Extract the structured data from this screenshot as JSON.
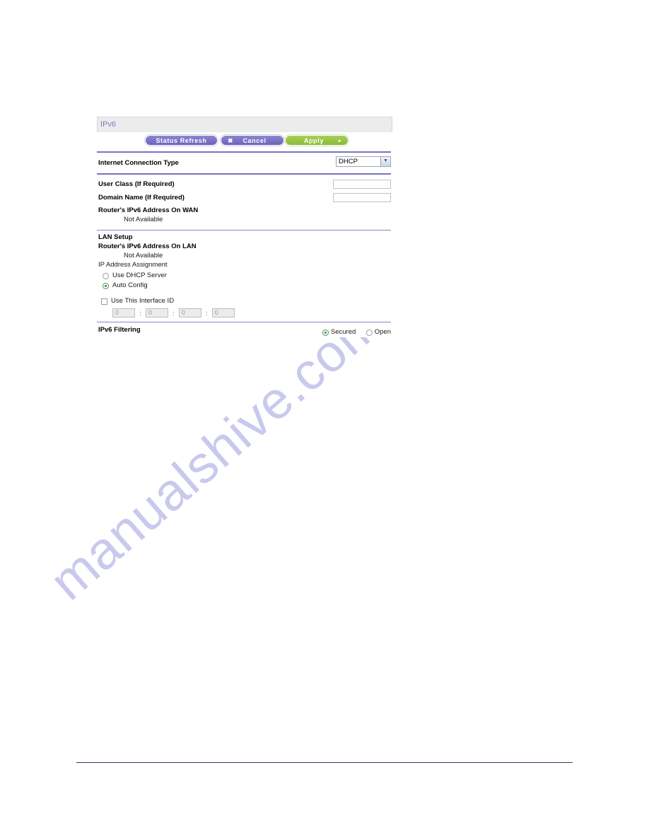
{
  "panel": {
    "title": "IPv6",
    "buttons": {
      "status_refresh": "Status Refresh",
      "cancel": "Cancel",
      "cancel_icon": "✖",
      "apply": "Apply",
      "apply_icon": "▸"
    },
    "internet_connection_type": {
      "label": "Internet Connection Type",
      "selected": "DHCP",
      "options": [
        "DHCP"
      ],
      "dropdown_icon": "▼"
    },
    "user_class": {
      "label": "User Class  (If Required)",
      "value": "",
      "placeholder": ""
    },
    "domain_name": {
      "label": "Domain Name   (If Required)",
      "value": "",
      "placeholder": ""
    },
    "wan_address": {
      "label": "Router's IPv6 Address On WAN",
      "value": "Not Available"
    },
    "lan_setup": {
      "heading": "LAN Setup",
      "lan_address": {
        "label": "Router's IPv6 Address On LAN",
        "value": "Not Available"
      },
      "ip_assignment": {
        "label": "IP Address Assignment",
        "options": [
          {
            "label": "Use DHCP Server",
            "checked": false
          },
          {
            "label": "Auto Config",
            "checked": true
          }
        ]
      },
      "interface_id": {
        "checkbox_label": "Use This Interface ID",
        "checked": false,
        "fields": [
          "0",
          "0",
          "0",
          "0"
        ],
        "separator": ":"
      }
    },
    "ipv6_filtering": {
      "label": "IPv6 Filtering",
      "options": [
        {
          "label": "Secured",
          "checked": true
        },
        {
          "label": "Open",
          "checked": false
        }
      ]
    }
  },
  "watermark": {
    "text": "manualshive.com"
  },
  "colors": {
    "accent_purple": "#7b72c0",
    "title_purple": "#7b7bc4",
    "apply_green": "#8cbb38",
    "button_purple": "#6d63bb",
    "watermark": "#c9c9ee",
    "page_rule": "#4a2d5e"
  }
}
